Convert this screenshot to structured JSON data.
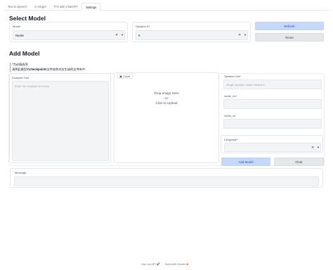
{
  "tabs": [
    "Text to Speech",
    "AI Singer",
    "TTS with ChatGPT",
    "Settings"
  ],
  "active_tab": "Settings",
  "select_model": {
    "title": "Select Model",
    "model_label": "Model",
    "model_value": "Nuoke",
    "speaker_label": "Speaker ID",
    "speaker_value": "0",
    "refresh_label": "Refresh",
    "reset_label": "Reset"
  },
  "add_model": {
    "title": "Add Model",
    "note_line1": "*为必填选项",
    "note_line2_pre": "请将此模型的",
    "note_line2_bold": "checkpoints",
    "note_line2_post": "文件放到对应生成的文件夹中",
    "example_text_label": "Example Text",
    "example_text_placeholder": "Enter the example text here",
    "cover_label": "Cover",
    "upload_line1": "Drop Image Here",
    "upload_line2": "- or -",
    "upload_line3": "Click to Upload",
    "speaker_list_label": "Speaker List*",
    "speaker_list_placeholder": "Single speaker model default:0",
    "name_en_label": "name_en*",
    "name_en_value": "",
    "name_cn_label": "name_cn",
    "name_cn_value": "",
    "language_label": "Language*",
    "language_value": "",
    "add_button_label": "Add Model",
    "clear_button_label": "Clear",
    "message_label": "Message",
    "message_value": ""
  },
  "footer": {
    "api_text": "Use via API",
    "built_text": "Built with Gradio"
  },
  "colors": {
    "primary_button_bg": "#c7d9fb",
    "primary_button_text": "#1d4ed8",
    "secondary_button_bg": "#e5e7eb",
    "field_bg": "#f3f4f6",
    "border": "#e5e7eb"
  }
}
